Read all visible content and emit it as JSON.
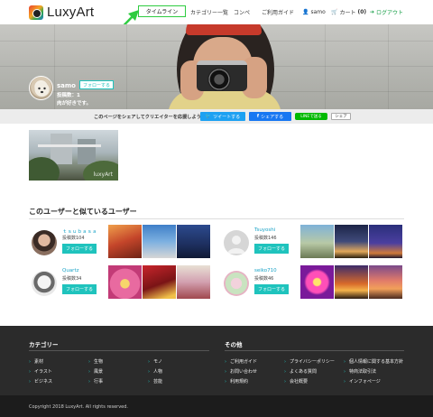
{
  "header": {
    "logo": "LuxyArt",
    "nav": {
      "timeline": "タイムライン",
      "category": "カテゴリー一覧",
      "contest": "コンペ",
      "guide": "ご利用ガイド",
      "user": "samo",
      "cart": "カート",
      "cart_count": "(0)",
      "logout": "ログアウト"
    }
  },
  "profile": {
    "name": "samo",
    "follow_label": "フォローする",
    "posts": "投稿数：1",
    "bio": "肉が好きです。"
  },
  "share": {
    "text": "このページをシェアしてクリエイターを応援しよう！",
    "twitter": "ツイートする",
    "facebook": "シェアする",
    "line": "LINEで送る",
    "other": "シェア"
  },
  "post": {
    "watermark": "luxyArt"
  },
  "similar": {
    "title": "このユーザーと似ているユーザー",
    "users": [
      {
        "name": "ｔｓｕｂａｓａ",
        "posts": "投稿数104",
        "follow": "フォローする"
      },
      {
        "name": "Tsuyoshi",
        "posts": "投稿数146",
        "follow": "フォローする"
      },
      {
        "name": "Quartz",
        "posts": "投稿数34",
        "follow": "フォローする"
      },
      {
        "name": "seiko710",
        "posts": "投稿数46",
        "follow": "フォローする"
      }
    ]
  },
  "footer": {
    "category_title": "カテゴリー",
    "categories": [
      "素材",
      "生物",
      "モノ",
      "イラスト",
      "風景",
      "人物",
      "ビジネス",
      "行事",
      "芸能"
    ],
    "other_title": "その他",
    "others": [
      "ご利用ガイド",
      "プライバシーポリシー",
      "個人情報に関する基本方針",
      "お問い合わせ",
      "よくある質問",
      "特商法取引法",
      "利用規約",
      "会社概要",
      "インフォページ"
    ],
    "copyright": "Copyright 2018 LuxyArt. All rights reserved."
  },
  "colors": {
    "accent": "#1fc3bd",
    "highlight": "#2ecc40",
    "footer_bg": "#2b2b2b"
  }
}
